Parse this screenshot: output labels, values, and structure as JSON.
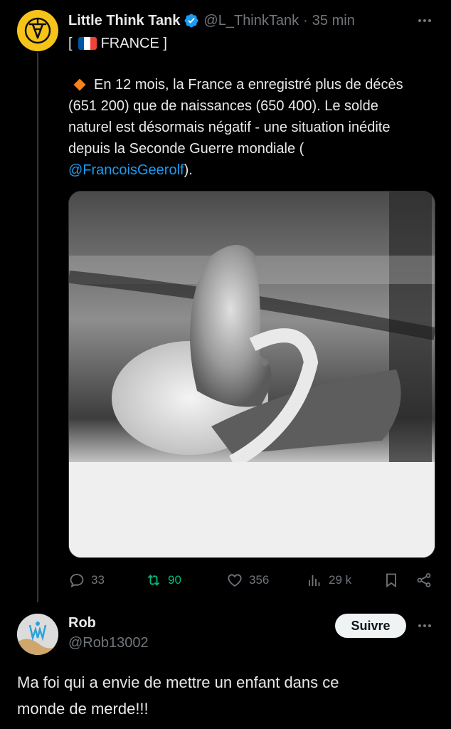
{
  "tweet": {
    "author": {
      "display_name": "Little Think Tank",
      "handle": "@L_ThinkTank",
      "verified": true,
      "avatar_icon": "oil-derrick-logo-icon",
      "avatar_color": "#f6c419"
    },
    "separator": "·",
    "time": "35 min",
    "tag": {
      "open_bracket": "[",
      "flag_icon": "france-flag-icon",
      "label": "FRANCE ]"
    },
    "text": {
      "bullet_icon": "orange-diamond-icon",
      "line1": "En 12 mois, la France a enregistré plus de décès",
      "line2": "(651 200) que de naissances (650 400). Le solde",
      "line3": "naturel est désormais négatif - une situation inédite",
      "line4": "depuis la Seconde Guerre mondiale (",
      "mention": "@FrancoisGeerolf",
      "line5_suffix": ")."
    },
    "media": {
      "description_icon": "photo-baby-foot-hospital-bracelet"
    },
    "actions": {
      "replies": "33",
      "retweets": "90",
      "likes": "356",
      "views": "29 k"
    }
  },
  "reply": {
    "author": {
      "display_name": "Rob",
      "handle": "@Rob13002",
      "avatar_icon": "om-club-crest-icon"
    },
    "follow_label": "Suivre",
    "text": {
      "line1": "Ma foi qui a envie de mettre un enfant dans ce",
      "line2": "monde de merde!!!"
    }
  },
  "colors": {
    "background": "#000000",
    "text": "#e7e9ea",
    "secondary": "#71767b",
    "link": "#1d9bf0",
    "verified": "#1d9bf0",
    "retweet": "#00ba7c",
    "bullet": "#f5821f"
  }
}
